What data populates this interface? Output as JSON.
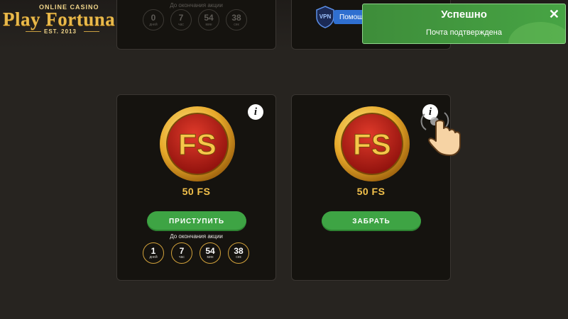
{
  "logo": {
    "tagline": "ONLINE CASINO",
    "brand": "Play Fortuna",
    "established": "EST. 2013"
  },
  "header": {
    "vpn_label": "VPN",
    "help_label": "Помощь"
  },
  "top_cards": {
    "countdown_label": "До окончания акции",
    "card1": [
      {
        "value": "0",
        "unit": "дней"
      },
      {
        "value": "7",
        "unit": "час"
      },
      {
        "value": "54",
        "unit": "мин"
      },
      {
        "value": "38",
        "unit": "сек"
      }
    ]
  },
  "promo_cards": [
    {
      "coin_text": "FS",
      "amount": "50 FS",
      "button": "ПРИСТУПИТЬ",
      "countdown_label": "До окончания акции",
      "countdown": [
        {
          "value": "1",
          "unit": "дней"
        },
        {
          "value": "7",
          "unit": "час"
        },
        {
          "value": "54",
          "unit": "мин"
        },
        {
          "value": "38",
          "unit": "сек"
        }
      ]
    },
    {
      "coin_text": "FS",
      "amount": "50 FS",
      "button": "ЗАБРАТЬ"
    }
  ],
  "toast": {
    "title": "Успешно",
    "message": "Почта подтверждена",
    "close": "✕",
    "color": "#47a444"
  },
  "colors": {
    "background": "#272420",
    "card": "#15130f",
    "accent_gold": "#f2c14b",
    "button_green": "#3ea444"
  }
}
